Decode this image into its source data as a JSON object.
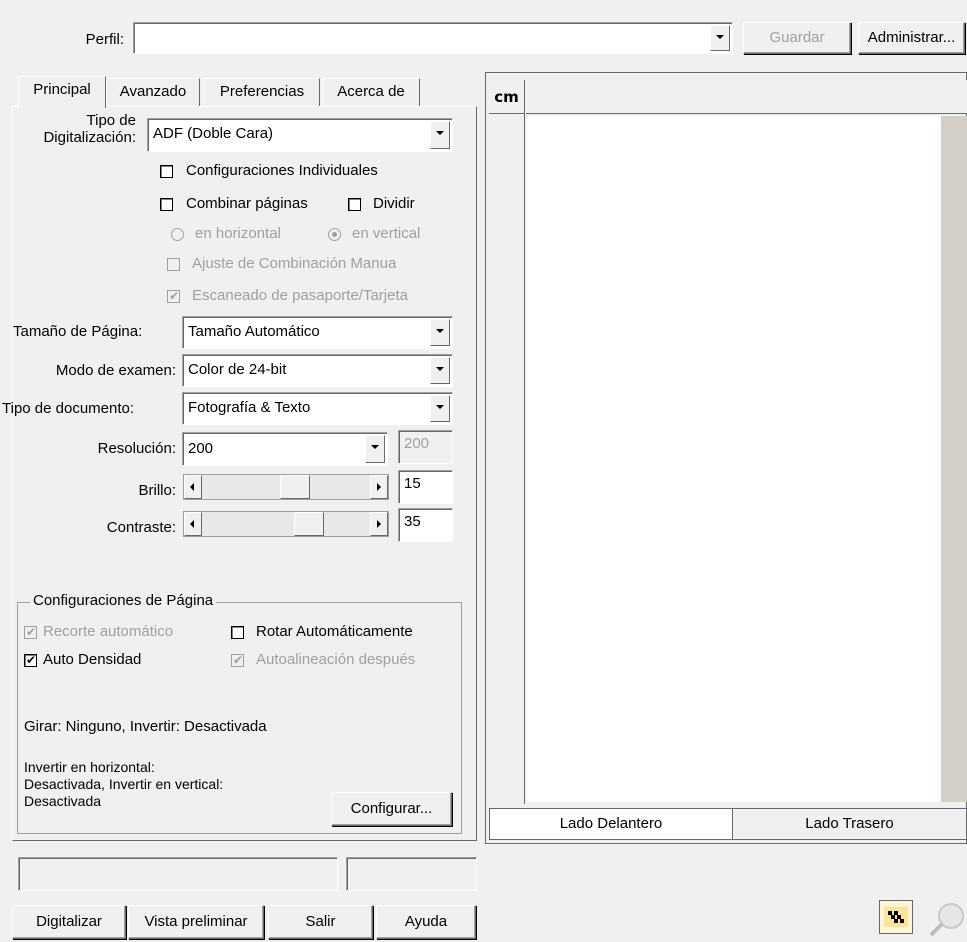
{
  "profile": {
    "label": "Perfil:",
    "value": "",
    "save_label": "Guardar",
    "manage_label": "Administrar..."
  },
  "tabs": [
    {
      "label": "Principal"
    },
    {
      "label": "Avanzado"
    },
    {
      "label": "Preferencias"
    },
    {
      "label": "Acerca de"
    }
  ],
  "main": {
    "scan_type_label": "Tipo de\nDigitalización:",
    "scan_type_label_1": "Tipo de",
    "scan_type_label_2": "Digitalización:",
    "scan_type_value": "ADF (Doble Cara)",
    "individual_settings": "Configuraciones Individuales",
    "merge_pages": "Combinar páginas",
    "split": "Dividir",
    "horizontal": "en horizontal",
    "vertical": "en vertical",
    "manual_merge": "Ajuste de Combinación Manua",
    "passport_scan": "Escaneado de pasaporte/Tarjeta",
    "page_size_label": "Tamaño de Página:",
    "page_size_value": "Tamaño Automático",
    "scan_mode_label": "Modo de examen:",
    "scan_mode_value": "Color de 24-bit",
    "doc_type_label": "Tipo de documento:",
    "doc_type_value": "Fotografía & Texto",
    "resolution_label": "Resolución:",
    "resolution_value": "200",
    "resolution_custom": "200",
    "brightness_label": "Brillo:",
    "brightness_value": "15",
    "contrast_label": "Contraste:",
    "contrast_value": "35"
  },
  "page_settings": {
    "title": "Configuraciones de Página",
    "auto_crop": "Recorte automático",
    "auto_rotate": "Rotar Automáticamente",
    "auto_density": "Auto Densidad",
    "auto_deskew": "Autoalineación después",
    "summary1": "Girar: Ninguno, Invertir: Desactivada",
    "summary2_1": "Invertir en horizontal:",
    "summary2_2": "Desactivada, Invertir en vertical:",
    "summary2_3": "Desactivada",
    "configure_label": "Configurar..."
  },
  "preview": {
    "front_tab": "Lado Delantero",
    "back_tab": "Lado Trasero"
  },
  "bottom": {
    "scan": "Digitalizar",
    "preview": "Vista preliminar",
    "exit": "Salir",
    "help": "Ayuda"
  },
  "icons": [
    "ruler-units-icon",
    "scanner-icon",
    "help-magnifier-icon"
  ]
}
